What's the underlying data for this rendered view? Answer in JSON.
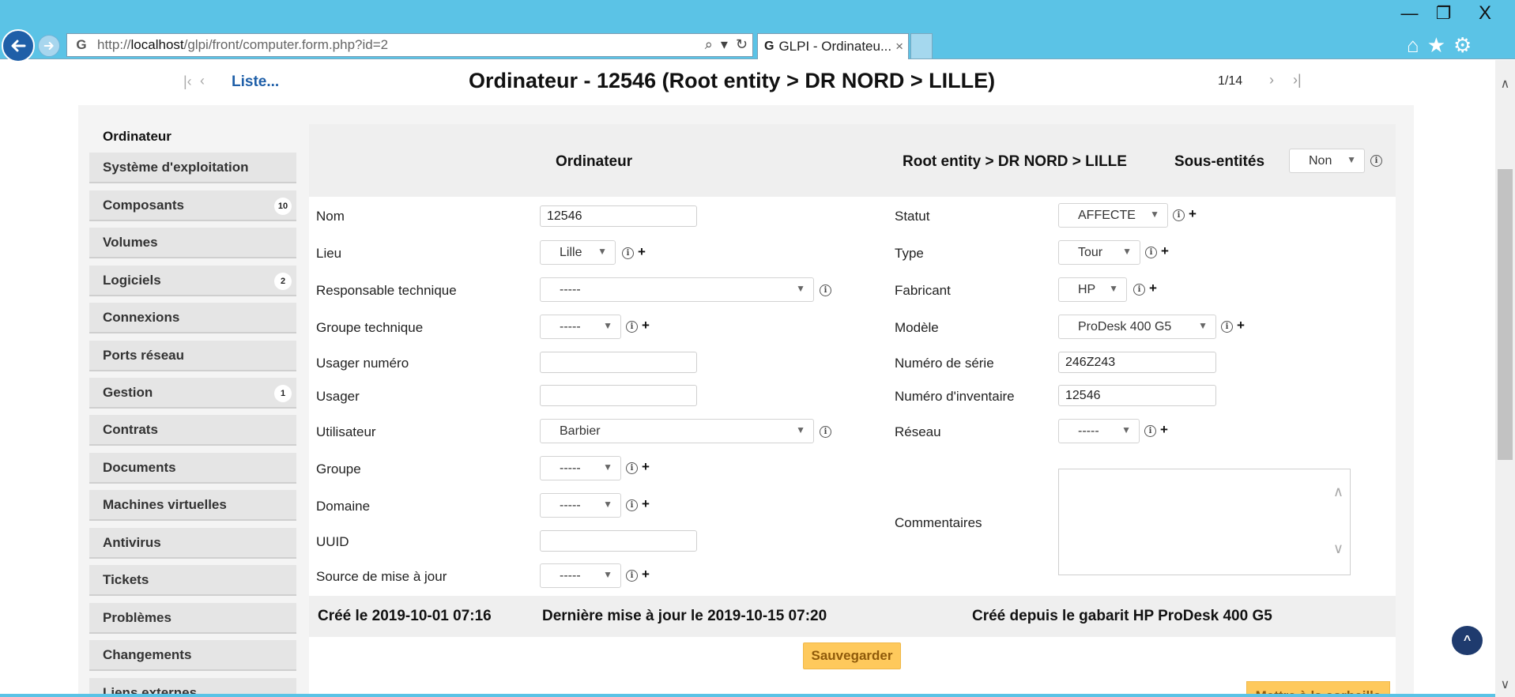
{
  "browser": {
    "window_controls": {
      "minimize": "—",
      "maximize": "❐",
      "close": "X"
    },
    "url_host": "localhost",
    "url_prefix": "http://",
    "url_path": "/glpi/front/computer.form.php?id=2",
    "tab_title": "GLPI - Ordinateu...",
    "tab_close": "×",
    "icons": [
      "back-icon",
      "forward-icon",
      "search-icon",
      "refresh-icon",
      "home-icon",
      "favorites-star-icon",
      "settings-gear-icon"
    ]
  },
  "header": {
    "list_link": "Liste...",
    "title": "Ordinateur - 12546 (Root entity > DR NORD > LILLE)",
    "pager_count": "1/14"
  },
  "sidebar": {
    "items": [
      {
        "label": "Ordinateur",
        "badge": ""
      },
      {
        "label": "Système d'exploitation",
        "badge": ""
      },
      {
        "label": "Composants",
        "badge": "10"
      },
      {
        "label": "Volumes",
        "badge": ""
      },
      {
        "label": "Logiciels",
        "badge": "2"
      },
      {
        "label": "Connexions",
        "badge": ""
      },
      {
        "label": "Ports réseau",
        "badge": ""
      },
      {
        "label": "Gestion",
        "badge": "1"
      },
      {
        "label": "Contrats",
        "badge": ""
      },
      {
        "label": "Documents",
        "badge": ""
      },
      {
        "label": "Machines virtuelles",
        "badge": ""
      },
      {
        "label": "Antivirus",
        "badge": ""
      },
      {
        "label": "Tickets",
        "badge": ""
      },
      {
        "label": "Problèmes",
        "badge": ""
      },
      {
        "label": "Changements",
        "badge": ""
      },
      {
        "label": "Liens externes",
        "badge": ""
      }
    ]
  },
  "form": {
    "heading": "Ordinateur",
    "entity": "Root entity > DR NORD > LILLE",
    "subentities_label": "Sous-entités",
    "subentities_value": "Non",
    "left": {
      "nom_label": "Nom",
      "nom_value": "12546",
      "lieu_label": "Lieu",
      "lieu_value": "Lille",
      "resp_tech_label": "Responsable technique",
      "resp_tech_value": "-----",
      "groupe_tech_label": "Groupe technique",
      "groupe_tech_value": "-----",
      "usager_numero_label": "Usager numéro",
      "usager_numero_value": "",
      "usager_label": "Usager",
      "usager_value": "",
      "utilisateur_label": "Utilisateur",
      "utilisateur_value": "Barbier",
      "groupe_label": "Groupe",
      "groupe_value": "-----",
      "domaine_label": "Domaine",
      "domaine_value": "-----",
      "uuid_label": "UUID",
      "uuid_value": "",
      "source_label": "Source de mise à jour",
      "source_value": "-----"
    },
    "right": {
      "statut_label": "Statut",
      "statut_value": "AFFECTE",
      "type_label": "Type",
      "type_value": "Tour",
      "fabricant_label": "Fabricant",
      "fabricant_value": "HP",
      "modele_label": "Modèle",
      "modele_value": "ProDesk 400 G5",
      "serie_label": "Numéro de série",
      "serie_value": "246Z243",
      "inventaire_label": "Numéro d'inventaire",
      "inventaire_value": "12546",
      "reseau_label": "Réseau",
      "reseau_value": "-----",
      "commentaires_label": "Commentaires",
      "commentaires_value": ""
    },
    "footer": {
      "created": "Créé le 2019-10-01 07:16",
      "updated": "Dernière mise à jour le 2019-10-15 07:20",
      "template": "Créé depuis le gabarit HP ProDesk 400 G5"
    },
    "save_label": "Sauvegarder",
    "trash_label": "Mettre à la corbeille"
  },
  "scroll_top_label": "^",
  "colors": {
    "chrome": "#5bc3e6",
    "link": "#1f5fa8",
    "button": "#fec95c",
    "button_text": "#8f5a0a",
    "scroll_top": "#1f3b6e"
  }
}
